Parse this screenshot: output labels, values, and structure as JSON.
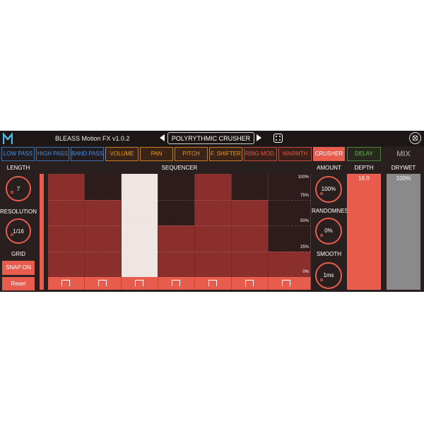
{
  "header": {
    "title": "BLEASS Motion FX  v1.0.2",
    "preset": "POLYRYTHMIC CRUSHER"
  },
  "tabs": [
    {
      "label": "LOW PASS",
      "style": "blue"
    },
    {
      "label": "HIGH PASS",
      "style": "blue"
    },
    {
      "label": "BAND PASS",
      "style": "blue"
    },
    {
      "label": "VOLUME",
      "style": "orange"
    },
    {
      "label": "PAN",
      "style": "orange"
    },
    {
      "label": "PITCH",
      "style": "orange"
    },
    {
      "label": "F. SHIFTER",
      "style": "orange"
    },
    {
      "label": "RING MOD.",
      "style": "red"
    },
    {
      "label": "WARMTH",
      "style": "red"
    },
    {
      "label": "CRUSHER",
      "style": "active"
    },
    {
      "label": "DELAY",
      "style": "green"
    }
  ],
  "left": {
    "length_label": "LENGTH",
    "length_value": "7",
    "resolution_label": "RESOLUTION",
    "resolution_value": "1/16",
    "grid_label": "GRID",
    "snap_label": "SNAP ON",
    "reset_label": "Reset"
  },
  "sequencer": {
    "title": "SEQUENCER",
    "scale": [
      "100%",
      "75%",
      "50%",
      "25%",
      "0%"
    ],
    "steps": [
      {
        "level": 1.0,
        "selected": false
      },
      {
        "level": 0.75,
        "selected": false
      },
      {
        "level": 1.0,
        "selected": true
      },
      {
        "level": 0.5,
        "selected": false
      },
      {
        "level": 1.0,
        "selected": false
      },
      {
        "level": 0.75,
        "selected": false
      },
      {
        "level": 0.25,
        "selected": false
      }
    ]
  },
  "right": {
    "amount_label": "AMOUNT",
    "amount_value": "100%",
    "randomness_label": "RANDOMNESS",
    "randomness_value": "0%",
    "smooth_label": "SMOOTH",
    "smooth_value": "1ms",
    "depth_label": "DEPTH",
    "depth_value": "16.0",
    "mix_title": "MIX",
    "drywet_label": "DRYWET",
    "drywet_value": "100%"
  },
  "colors": {
    "accent": "#e85c4e",
    "background": "#2a1f1f",
    "bar": "#8a2f2c",
    "selected_bar": "#efe6e3"
  }
}
